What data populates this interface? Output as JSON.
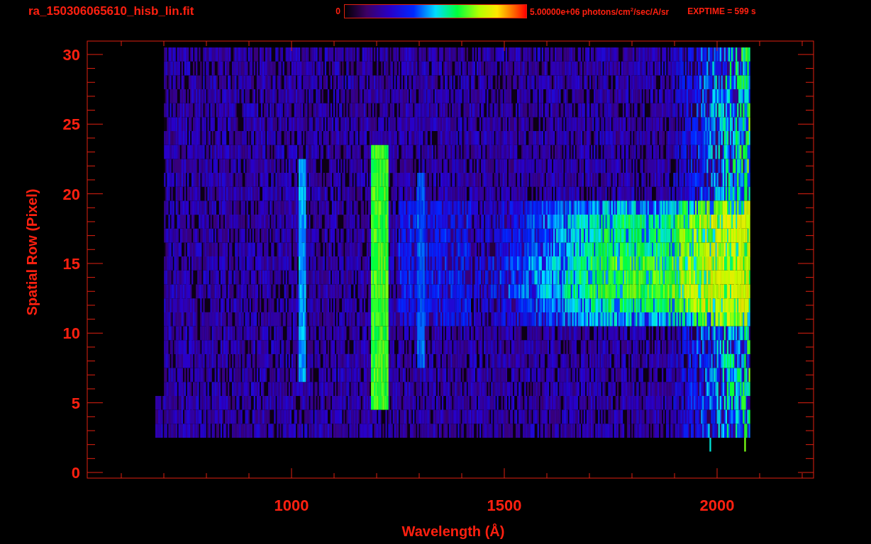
{
  "header": {
    "title": "ra_150306065610_hisb_lin.fit",
    "colorbar": {
      "min_label": "0",
      "max_label": "5.00000e+06 photons/cm$^{2}$/sec/A/sr"
    },
    "exposure": "EXPTIME = 599 s"
  },
  "plot": {
    "x_axis": {
      "label": "Wavelength (Å)",
      "ticks": [
        "1000",
        "1500",
        "2000"
      ]
    },
    "y_axis": {
      "label": "Spatial Row (Pixel)",
      "ticks": [
        "30",
        "25",
        "20",
        "15",
        "10",
        "5",
        "0"
      ]
    }
  }
}
